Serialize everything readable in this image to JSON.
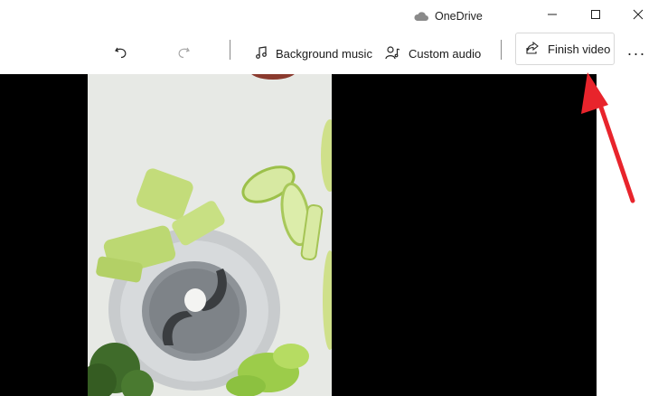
{
  "titlebar": {
    "onedrive_label": "OneDrive",
    "icons": [
      "cloud-icon",
      "minimize-icon",
      "maximize-icon",
      "close-icon"
    ]
  },
  "toolbar": {
    "undo_icon": "undo-icon",
    "redo_icon": "redo-icon",
    "background_music_label": "Background music",
    "custom_audio_label": "Custom audio",
    "finish_video_label": "Finish video",
    "more_label": "···"
  },
  "colors": {
    "accent_arrow": "#e8242c",
    "stage": "#000000"
  }
}
